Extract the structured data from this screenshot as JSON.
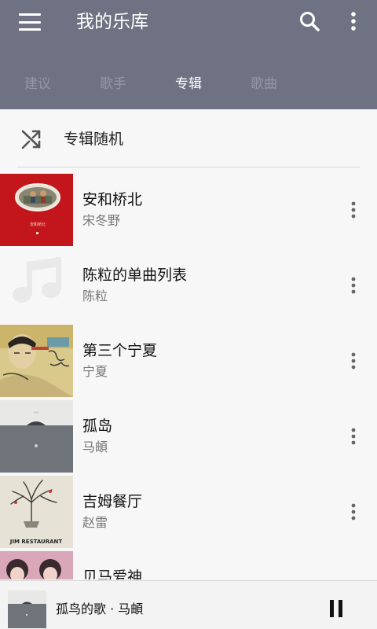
{
  "app": {
    "title": "我的乐库",
    "menu_icon": "hamburger-menu-icon",
    "search_icon": "search-icon",
    "more_icon": "more-vert-icon",
    "header_color": "#6e7282"
  },
  "tabs": [
    {
      "label": "建议",
      "active": false
    },
    {
      "label": "歌手",
      "active": false
    },
    {
      "label": "专辑",
      "active": true
    },
    {
      "label": "歌曲",
      "active": false
    }
  ],
  "shuffle": {
    "label": "专辑随机",
    "icon": "shuffle-icon"
  },
  "albums": [
    {
      "title": "安和桥北",
      "artist": "宋冬野"
    },
    {
      "title": "陈粒的单曲列表",
      "artist": "陈粒"
    },
    {
      "title": "第三个宁夏",
      "artist": "宁夏"
    },
    {
      "title": "孤岛",
      "artist": "马頔"
    },
    {
      "title": "吉姆餐厅",
      "artist": "赵雷"
    },
    {
      "title": "贝马爱神",
      "artist": ""
    }
  ],
  "covers": {
    "album1_text": "安和桥北",
    "album5_text": "JIM RESTAURANT"
  },
  "player": {
    "now_playing": "孤鸟的歌 · 马頔",
    "pause_icon": "pause-icon"
  }
}
